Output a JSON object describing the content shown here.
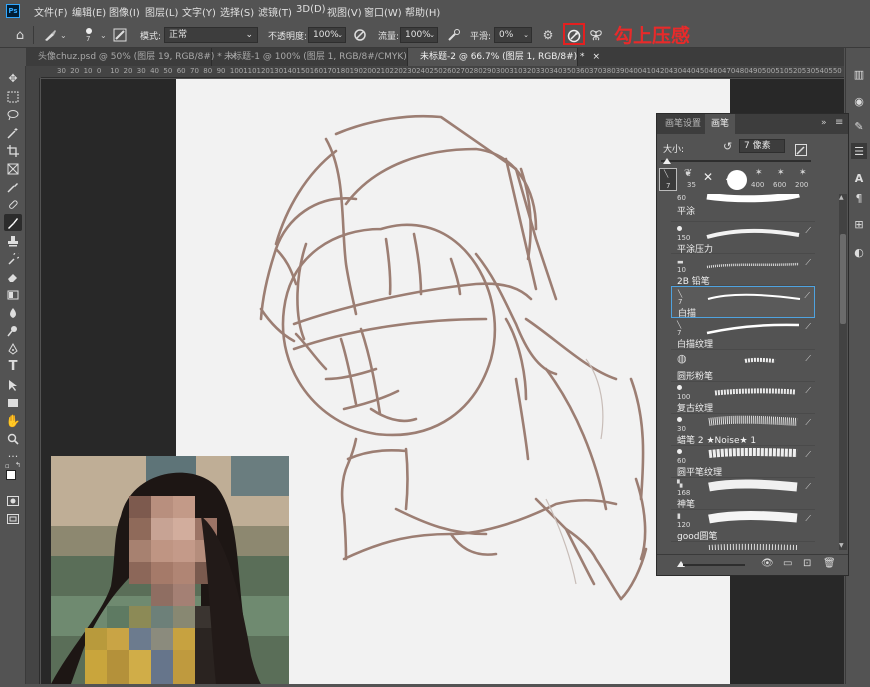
{
  "app": {
    "logo": "Ps"
  },
  "menu": [
    "文件(F)",
    "编辑(E)",
    "图像(I)",
    "图层(L)",
    "文字(Y)",
    "选择(S)",
    "滤镜(T)",
    "3D(D)",
    "视图(V)",
    "窗口(W)",
    "帮助(H)"
  ],
  "options": {
    "brush_size": "7",
    "mode_label": "模式:",
    "mode_value": "正常",
    "opacity_label": "不透明度:",
    "opacity_value": "100%",
    "flow_label": "流量:",
    "flow_value": "100%",
    "smooth_label": "平滑:",
    "smooth_value": "0%"
  },
  "callout": {
    "text": "勾上压感",
    "color": "#e82a2a"
  },
  "tabs": [
    {
      "label": "头像chuz.psd @ 50% (图层 19, RGB/8#) *",
      "close": "×"
    },
    {
      "label": "未标题-1 @ 100% (图层 1, RGB/8#/CMYK) *",
      "close": "×"
    },
    {
      "label": "未标题-2 @ 66.7% (图层 1, RGB/8#) *",
      "close": "×"
    }
  ],
  "ruler_top": [
    "30",
    "20",
    "10",
    "0",
    "10",
    "20",
    "30",
    "40",
    "50",
    "60",
    "70",
    "80",
    "90",
    "100",
    "110",
    "120",
    "130",
    "140",
    "150",
    "160",
    "170",
    "180",
    "190",
    "200",
    "210",
    "220",
    "230",
    "240",
    "250",
    "260",
    "270",
    "280",
    "290",
    "300",
    "310",
    "320",
    "330",
    "340",
    "350",
    "360",
    "370",
    "380",
    "390",
    "400",
    "410",
    "420",
    "430",
    "440",
    "450",
    "460",
    "470",
    "480",
    "490",
    "500",
    "510",
    "520",
    "530",
    "540",
    "550",
    "560"
  ],
  "brush_panel": {
    "tabs": [
      "画笔设置",
      "画笔"
    ],
    "size_label": "大小:",
    "size_value": "7 像素",
    "presets": [
      {
        "num": "7"
      },
      {
        "num": "35"
      },
      {
        "num": ""
      },
      {
        "num": ""
      },
      {
        "num": "400"
      },
      {
        "num": "600"
      },
      {
        "num": "200"
      }
    ],
    "brushes": [
      {
        "num": "60",
        "name": "平涂"
      },
      {
        "num": "150",
        "name": "平涂压力"
      },
      {
        "num": "10",
        "name": "2B 铅笔"
      },
      {
        "num": "7",
        "name": "白描"
      },
      {
        "num": "7",
        "name": "白描纹理"
      },
      {
        "num": "",
        "name": "圆形粉笔"
      },
      {
        "num": "100",
        "name": "复古纹理"
      },
      {
        "num": "30",
        "name": "蜡笔 2 ★Noise★ 1"
      },
      {
        "num": "60",
        "name": "圆平笔纹理"
      },
      {
        "num": "168",
        "name": "神笔"
      },
      {
        "num": "120",
        "name": "good圆笔"
      }
    ]
  }
}
